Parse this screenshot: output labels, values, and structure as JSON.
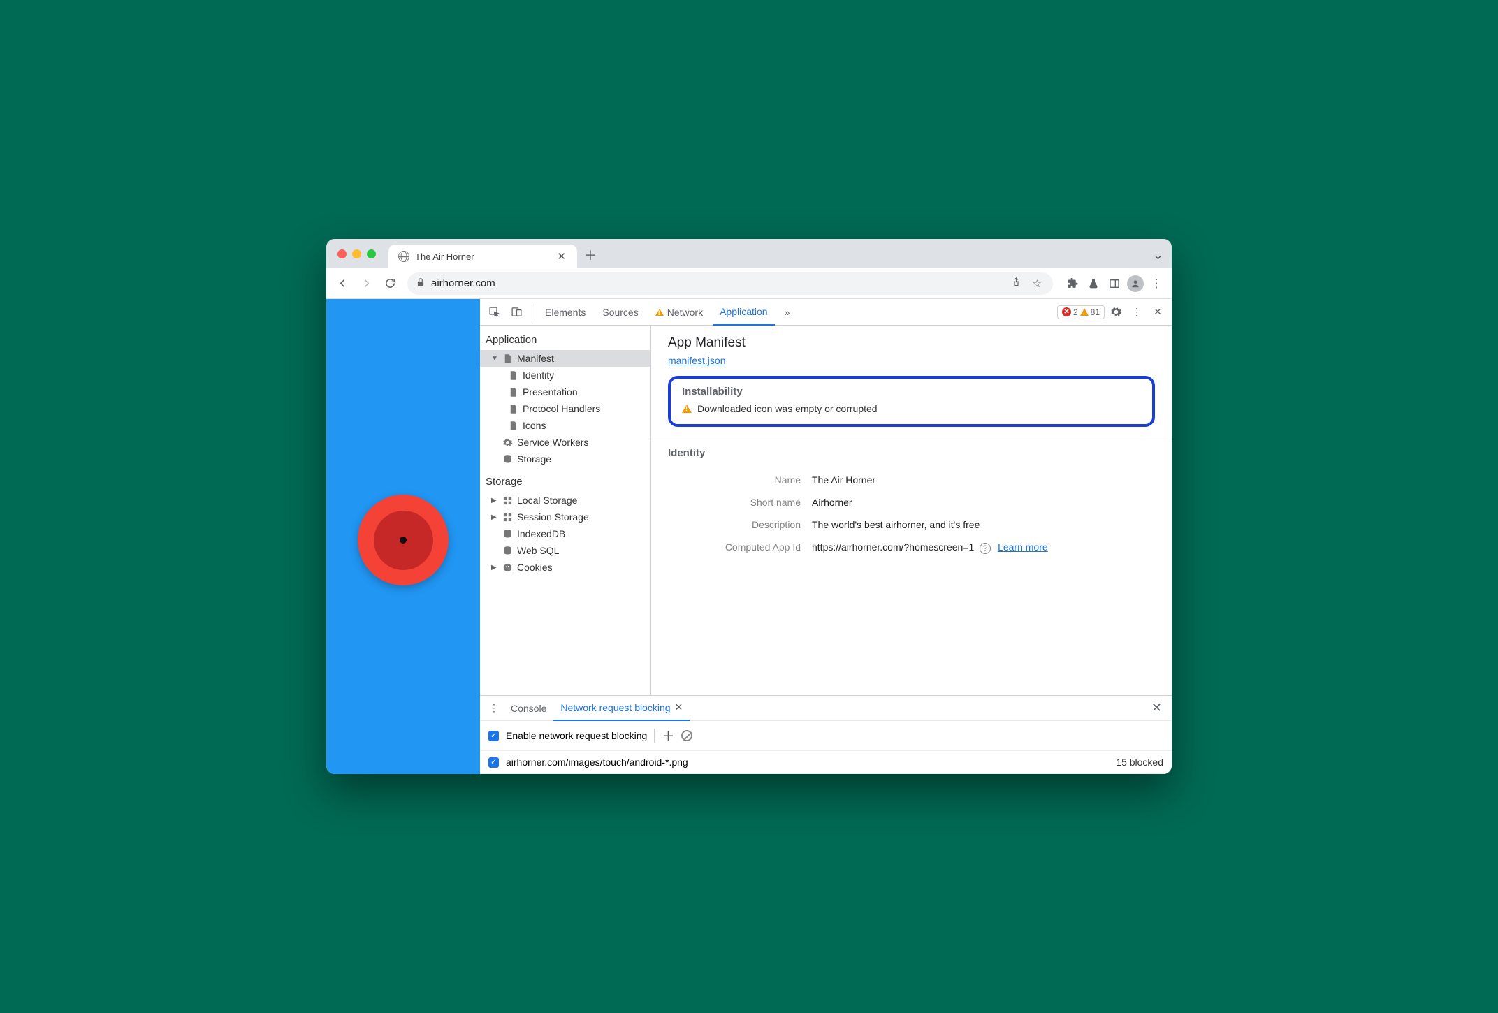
{
  "window": {
    "tab_title": "The Air Horner",
    "url": "airhorner.com"
  },
  "devtools": {
    "tabs": {
      "elements": "Elements",
      "sources": "Sources",
      "network": "Network",
      "application": "Application"
    },
    "errors_count": "2",
    "warnings_count": "81"
  },
  "sidebar": {
    "app_header": "Application",
    "manifest": "Manifest",
    "identity": "Identity",
    "presentation": "Presentation",
    "protocol": "Protocol Handlers",
    "icons": "Icons",
    "service_workers": "Service Workers",
    "storage_item": "Storage",
    "storage_header": "Storage",
    "local_storage": "Local Storage",
    "session_storage": "Session Storage",
    "indexeddb": "IndexedDB",
    "websql": "Web SQL",
    "cookies": "Cookies"
  },
  "manifest": {
    "heading": "App Manifest",
    "link": "manifest.json",
    "install_heading": "Installability",
    "install_warning": "Downloaded icon was empty or corrupted",
    "identity_heading": "Identity",
    "kv": {
      "name_k": "Name",
      "name_v": "The Air Horner",
      "short_k": "Short name",
      "short_v": "Airhorner",
      "desc_k": "Description",
      "desc_v": "The world's best airhorner, and it's free",
      "appid_k": "Computed App Id",
      "appid_v": "https://airhorner.com/?homescreen=1",
      "learn": "Learn more"
    }
  },
  "drawer": {
    "console": "Console",
    "nrb_tab": "Network request blocking",
    "enable_label": "Enable network request blocking",
    "pattern": "airhorner.com/images/touch/android-*.png",
    "blocked_count": "15 blocked"
  }
}
